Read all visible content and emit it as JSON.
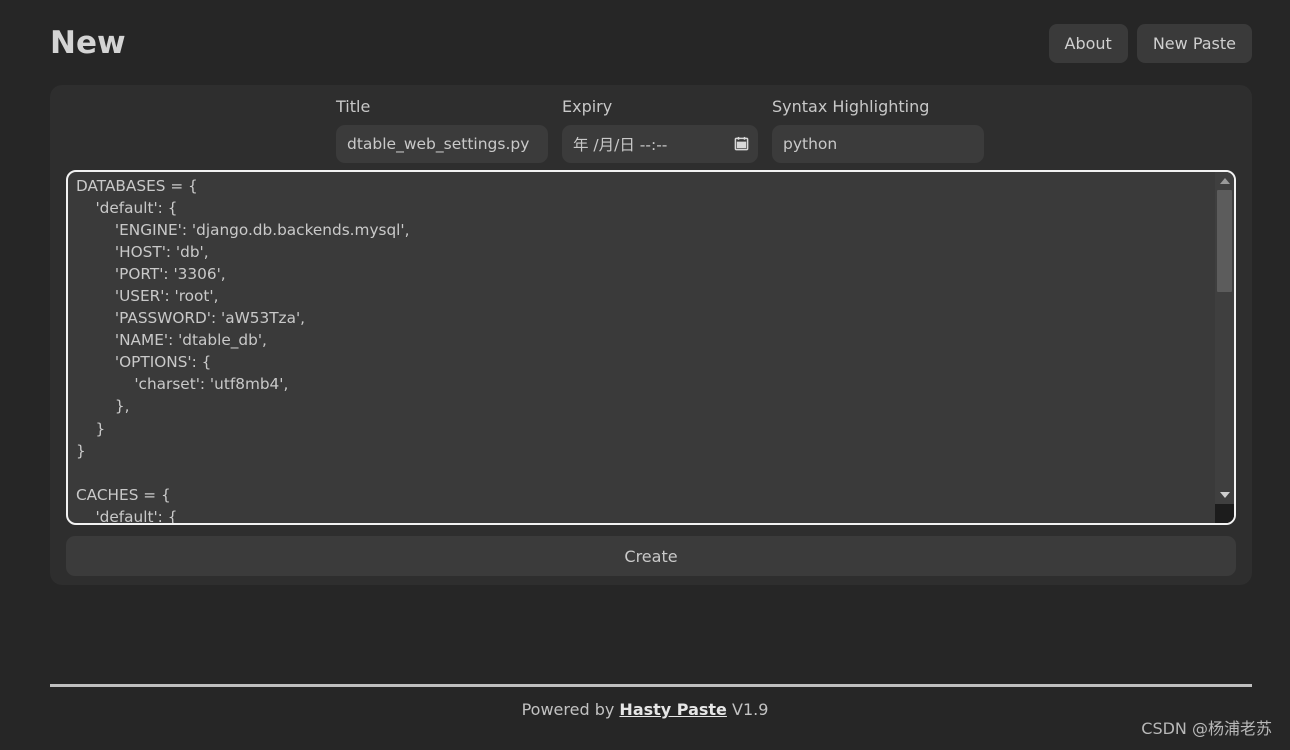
{
  "header": {
    "title": "New",
    "nav": [
      {
        "label": "About",
        "name": "about-button"
      },
      {
        "label": "New Paste",
        "name": "new-paste-button"
      }
    ]
  },
  "form": {
    "title": {
      "label": "Title",
      "value": "dtable_web_settings.py",
      "placeholder": "Title"
    },
    "expiry": {
      "label": "Expiry",
      "value": "年 /月/日 --:--",
      "icon": "calendar-icon"
    },
    "syntax": {
      "label": "Syntax Highlighting",
      "value": "python",
      "placeholder": "Syntax Highlighting"
    }
  },
  "editor": {
    "content": "DATABASES = {\n    'default': {\n        'ENGINE': 'django.db.backends.mysql',\n        'HOST': 'db',\n        'PORT': '3306',\n        'USER': 'root',\n        'PASSWORD': 'aW53Tza',\n        'NAME': 'dtable_db',\n        'OPTIONS': {\n            'charset': 'utf8mb4',\n        },\n    }\n}\n\nCACHES = {\n    'default': {",
    "scrollbar": {
      "up_arrow": "▲",
      "down_arrow": "▼"
    }
  },
  "actions": {
    "create_label": "Create"
  },
  "footer": {
    "prefix": "Powered by ",
    "link": "Hasty Paste",
    "suffix": " V1.9",
    "watermark": "CSDN @杨浦老苏"
  },
  "colors": {
    "page_background": "#262626",
    "card_background": "#2e2e2e",
    "input_background": "#3b3b3b",
    "editor_background": "#3a3a3a",
    "editor_border": "#f2f2f2",
    "text_primary": "#d4d4d4",
    "text_secondary": "#c9c9c9"
  }
}
